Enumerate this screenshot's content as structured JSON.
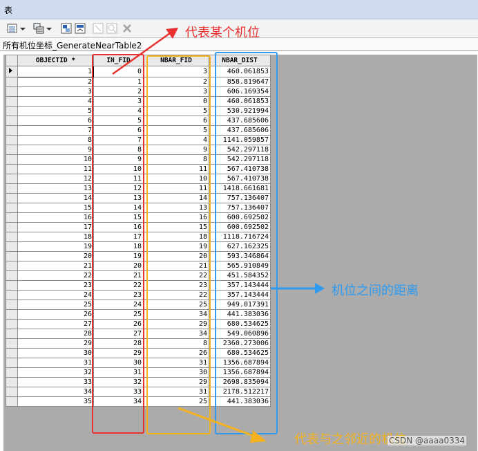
{
  "window": {
    "title": "表"
  },
  "tab": {
    "label": "所有机位坐标_GenerateNearTable2"
  },
  "table": {
    "columns": [
      "OBJECTID *",
      "IN_FID",
      "NBAR_FID",
      "NBAR_DIST"
    ],
    "rows": [
      [
        "1",
        "0",
        "3",
        "460.061853"
      ],
      [
        "2",
        "1",
        "2",
        "858.819647"
      ],
      [
        "3",
        "2",
        "3",
        "606.169354"
      ],
      [
        "4",
        "3",
        "0",
        "460.061853"
      ],
      [
        "5",
        "4",
        "5",
        "530.921994"
      ],
      [
        "6",
        "5",
        "6",
        "437.685606"
      ],
      [
        "7",
        "6",
        "5",
        "437.685606"
      ],
      [
        "8",
        "7",
        "4",
        "1141.059857"
      ],
      [
        "9",
        "8",
        "9",
        "542.297118"
      ],
      [
        "10",
        "9",
        "8",
        "542.297118"
      ],
      [
        "11",
        "10",
        "11",
        "567.410738"
      ],
      [
        "12",
        "11",
        "10",
        "567.410738"
      ],
      [
        "13",
        "12",
        "11",
        "1418.661681"
      ],
      [
        "14",
        "13",
        "14",
        "757.136407"
      ],
      [
        "15",
        "14",
        "13",
        "757.136407"
      ],
      [
        "16",
        "15",
        "16",
        "600.692502"
      ],
      [
        "17",
        "16",
        "15",
        "600.692502"
      ],
      [
        "18",
        "17",
        "18",
        "1118.716724"
      ],
      [
        "19",
        "18",
        "19",
        "627.162325"
      ],
      [
        "20",
        "19",
        "20",
        "593.346864"
      ],
      [
        "21",
        "20",
        "21",
        "565.910849"
      ],
      [
        "22",
        "21",
        "22",
        "451.584352"
      ],
      [
        "23",
        "22",
        "23",
        "357.143444"
      ],
      [
        "24",
        "23",
        "22",
        "357.143444"
      ],
      [
        "25",
        "24",
        "25",
        "949.017391"
      ],
      [
        "26",
        "25",
        "34",
        "441.383036"
      ],
      [
        "27",
        "26",
        "29",
        "680.534625"
      ],
      [
        "28",
        "27",
        "34",
        "549.060896"
      ],
      [
        "29",
        "28",
        "8",
        "2360.273006"
      ],
      [
        "30",
        "29",
        "26",
        "680.534625"
      ],
      [
        "31",
        "30",
        "31",
        "1356.687894"
      ],
      [
        "32",
        "31",
        "30",
        "1356.687894"
      ],
      [
        "33",
        "32",
        "29",
        "2698.835094"
      ],
      [
        "34",
        "33",
        "31",
        "2178.512217"
      ],
      [
        "35",
        "34",
        "25",
        "441.383036"
      ]
    ]
  },
  "annotations": {
    "in_fid": "代表某个机位",
    "distance": "机位之间的距离",
    "near_fid": "代表与之邻近的机位",
    "watermark": "CSDN @aaaa0334"
  },
  "colors": {
    "red": "#e8312f",
    "orange": "#f5b21e",
    "blue": "#2e9bf0",
    "header_bg": "#cfdcef"
  },
  "icons": [
    "table-options-icon",
    "related-tables-icon",
    "select-by-attributes-icon",
    "switch-selection-icon",
    "clear-selection-icon",
    "zoom-to-selected-icon",
    "delete-selected-icon"
  ]
}
